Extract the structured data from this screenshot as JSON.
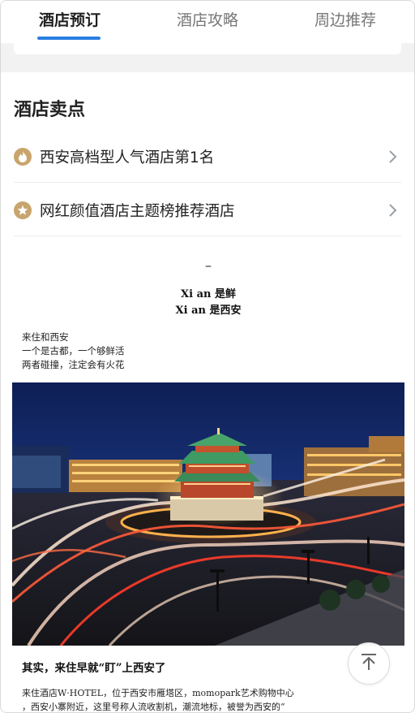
{
  "tabs": [
    {
      "label": "酒店预订",
      "active": true
    },
    {
      "label": "酒店攻略",
      "active": false
    },
    {
      "label": "周边推荐",
      "active": false
    }
  ],
  "selling_points": {
    "title": "酒店卖点",
    "items": [
      {
        "icon": "flame-icon",
        "text": "西安高档型人气酒店第1名"
      },
      {
        "icon": "star-icon",
        "text": "网红颜值酒店主题榜推荐酒店"
      }
    ]
  },
  "article": {
    "dash": "–",
    "heading_line1": "Xi an   是鲜",
    "heading_line2": "Xi an   是西安",
    "intro_lines": [
      "来住和西安",
      "一个是古都，一个够鲜活",
      "两者碰撞，注定会有火花"
    ],
    "photo_icon": "bell-tower-night-photo",
    "subheading": "其实，来住早就“盯”上西安了",
    "body_lines": [
      "来住酒店W·HOTEL，位于西安市雁塔区，momopark艺术购物中心",
      "，西安小寨附近，这里号称人流收割机，潮流地标，被誉为西安的“"
    ]
  },
  "back_to_top_icon": "back-to-top-icon",
  "colors": {
    "accent": "#2a7de1",
    "icon_gold": "#c8a56d"
  }
}
